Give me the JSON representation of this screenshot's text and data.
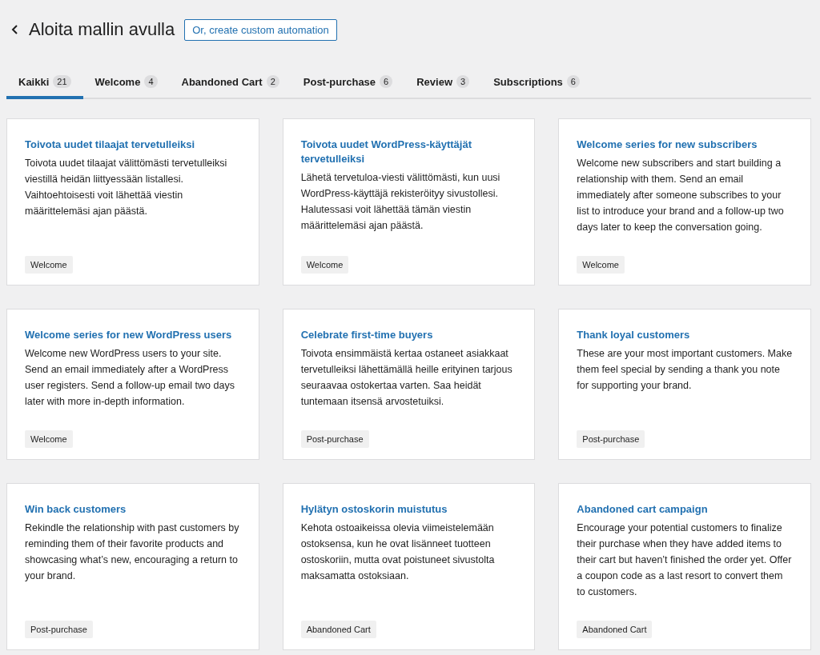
{
  "header": {
    "title": "Aloita mallin avulla",
    "custom_button": "Or, create custom automation"
  },
  "tabs": [
    {
      "label": "Kaikki",
      "count": "21",
      "selected": true
    },
    {
      "label": "Welcome",
      "count": "4",
      "selected": false
    },
    {
      "label": "Abandoned Cart",
      "count": "2",
      "selected": false
    },
    {
      "label": "Post-purchase",
      "count": "6",
      "selected": false
    },
    {
      "label": "Review",
      "count": "3",
      "selected": false
    },
    {
      "label": "Subscriptions",
      "count": "6",
      "selected": false
    }
  ],
  "templates": [
    {
      "title": "Toivota uudet tilaajat tervetulleiksi",
      "description": "Toivota uudet tilaajat välittömästi tervetulleiksi viestillä heidän liittyessään listallesi. Vaihtoehtoisesti voit lähettää viestin määrittelemäsi ajan päästä.",
      "tag": "Welcome"
    },
    {
      "title": "Toivota uudet WordPress-käyttäjät tervetulleiksi",
      "description": "Lähetä tervetuloa-viesti välittömästi, kun uusi WordPress-käyttäjä rekisteröityy sivustollesi. Halutessasi voit lähettää tämän viestin määrittelemäsi ajan päästä.",
      "tag": "Welcome"
    },
    {
      "title": "Welcome series for new subscribers",
      "description": "Welcome new subscribers and start building a relationship with them. Send an email immediately after someone subscribes to your list to introduce your brand and a follow-up two days later to keep the conversation going.",
      "tag": "Welcome"
    },
    {
      "title": "Welcome series for new WordPress users",
      "description": "Welcome new WordPress users to your site. Send an email immediately after a WordPress user registers. Send a follow-up email two days later with more in-depth information.",
      "tag": "Welcome"
    },
    {
      "title": "Celebrate first-time buyers",
      "description": "Toivota ensimmäistä kertaa ostaneet asiakkaat tervetulleiksi lähettämällä heille erityinen tarjous seuraavaa ostokertaa varten. Saa heidät tuntemaan itsensä arvostetuiksi.",
      "tag": "Post-purchase"
    },
    {
      "title": "Thank loyal customers",
      "description": "These are your most important customers. Make them feel special by sending a thank you note for supporting your brand.",
      "tag": "Post-purchase"
    },
    {
      "title": "Win back customers",
      "description": "Rekindle the relationship with past customers by reminding them of their favorite products and showcasing what’s new, encouraging a return to your brand.",
      "tag": "Post-purchase"
    },
    {
      "title": "Hylätyn ostoskorin muistutus",
      "description": "Kehota ostoaikeissa olevia viimeistelemään ostoksensa, kun he ovat lisänneet tuotteen ostoskoriin, mutta ovat poistuneet sivustolta maksamatta ostoksiaan.",
      "tag": "Abandoned Cart"
    },
    {
      "title": "Abandoned cart campaign",
      "description": "Encourage your potential customers to finalize their purchase when they have added items to their cart but haven’t finished the order yet. Offer a coupon code as a last resort to convert them to customers.",
      "tag": "Abandoned Cart"
    }
  ]
}
